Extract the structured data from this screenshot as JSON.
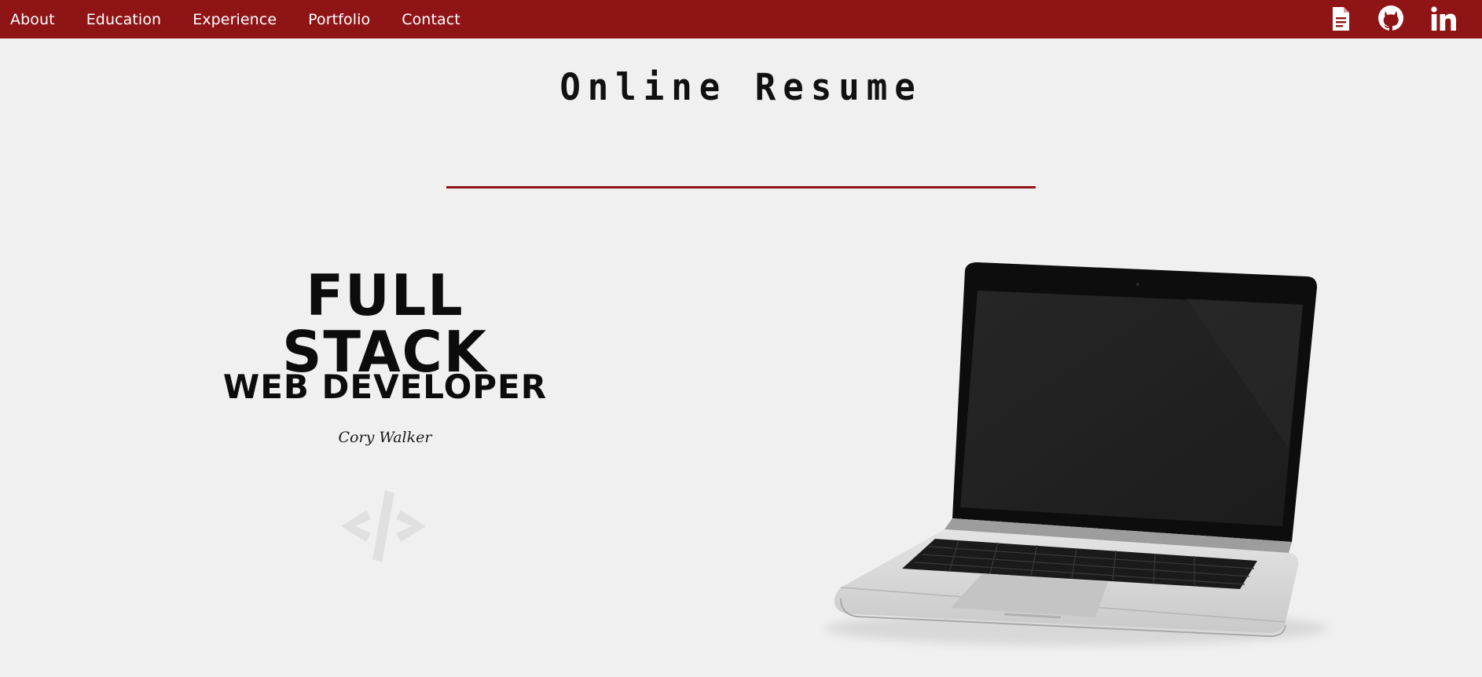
{
  "nav": {
    "links": [
      "About",
      "Education",
      "Experience",
      "Portfolio",
      "Contact"
    ],
    "icons": [
      "document-icon",
      "github-icon",
      "linkedin-icon"
    ]
  },
  "header": {
    "title": "Online Resume"
  },
  "hero": {
    "heading": "FULL STACK",
    "subheading": "WEB DEVELOPER",
    "name": "Cory Walker",
    "badge_icon": "code-icon"
  },
  "colors": {
    "nav_background": "#8f1416",
    "accent_rule": "#8f1416",
    "page_background": "#f0f0f0",
    "heading_text": "#0c0c0c"
  }
}
